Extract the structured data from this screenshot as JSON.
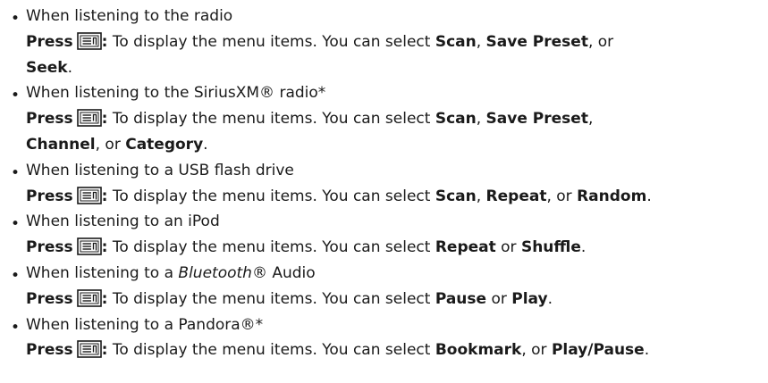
{
  "items": [
    {
      "condition_pre": "When listening to the radio",
      "condition_italic": "",
      "condition_post": "",
      "press": "Press",
      "desc_pre": ": To display the menu items. You can select ",
      "options_line1": [
        [
          "Scan",
          ", "
        ],
        [
          "Save Preset",
          ", or "
        ]
      ],
      "options_line2": [
        [
          "Seek",
          "."
        ]
      ]
    },
    {
      "condition_pre": "When listening to the SiriusXM® radio*",
      "condition_italic": "",
      "condition_post": "",
      "press": "Press",
      "desc_pre": ": To display the menu items. You can select ",
      "options_line1": [
        [
          "Scan",
          ", "
        ],
        [
          "Save Preset",
          ","
        ]
      ],
      "options_line2": [
        [
          "Channel",
          ", or "
        ],
        [
          "Category",
          "."
        ]
      ]
    },
    {
      "condition_pre": "When listening to a USB flash drive",
      "condition_italic": "",
      "condition_post": "",
      "press": "Press",
      "desc_pre": ": To display the menu items. You can select ",
      "options_line1": [
        [
          "Scan",
          ", "
        ],
        [
          "Repeat",
          ", or "
        ],
        [
          "Random",
          "."
        ]
      ],
      "options_line2": []
    },
    {
      "condition_pre": "When listening to an iPod",
      "condition_italic": "",
      "condition_post": "",
      "press": "Press",
      "desc_pre": ": To display the menu items. You can select ",
      "options_line1": [
        [
          "Repeat",
          " or "
        ],
        [
          "Shuffle",
          "."
        ]
      ],
      "options_line2": []
    },
    {
      "condition_pre": "When listening to a ",
      "condition_italic": "Bluetooth",
      "condition_post": "® Audio",
      "press": "Press",
      "desc_pre": ": To display the menu items. You can select ",
      "options_line1": [
        [
          "Pause",
          " or "
        ],
        [
          "Play",
          "."
        ]
      ],
      "options_line2": []
    },
    {
      "condition_pre": "When listening to a Pandora®*",
      "condition_italic": "",
      "condition_post": "",
      "press": "Press",
      "desc_pre": ": To display the menu items. You can select ",
      "options_line1": [
        [
          "Bookmark",
          ", or "
        ],
        [
          "Play/Pause",
          "."
        ]
      ],
      "options_line2": []
    }
  ],
  "icons": {
    "menu_button": "menu-button-icon",
    "bullet": "bullet-icon"
  },
  "colors": {
    "text": "#1a1a1a",
    "icon_stroke": "#1a1a1a"
  }
}
